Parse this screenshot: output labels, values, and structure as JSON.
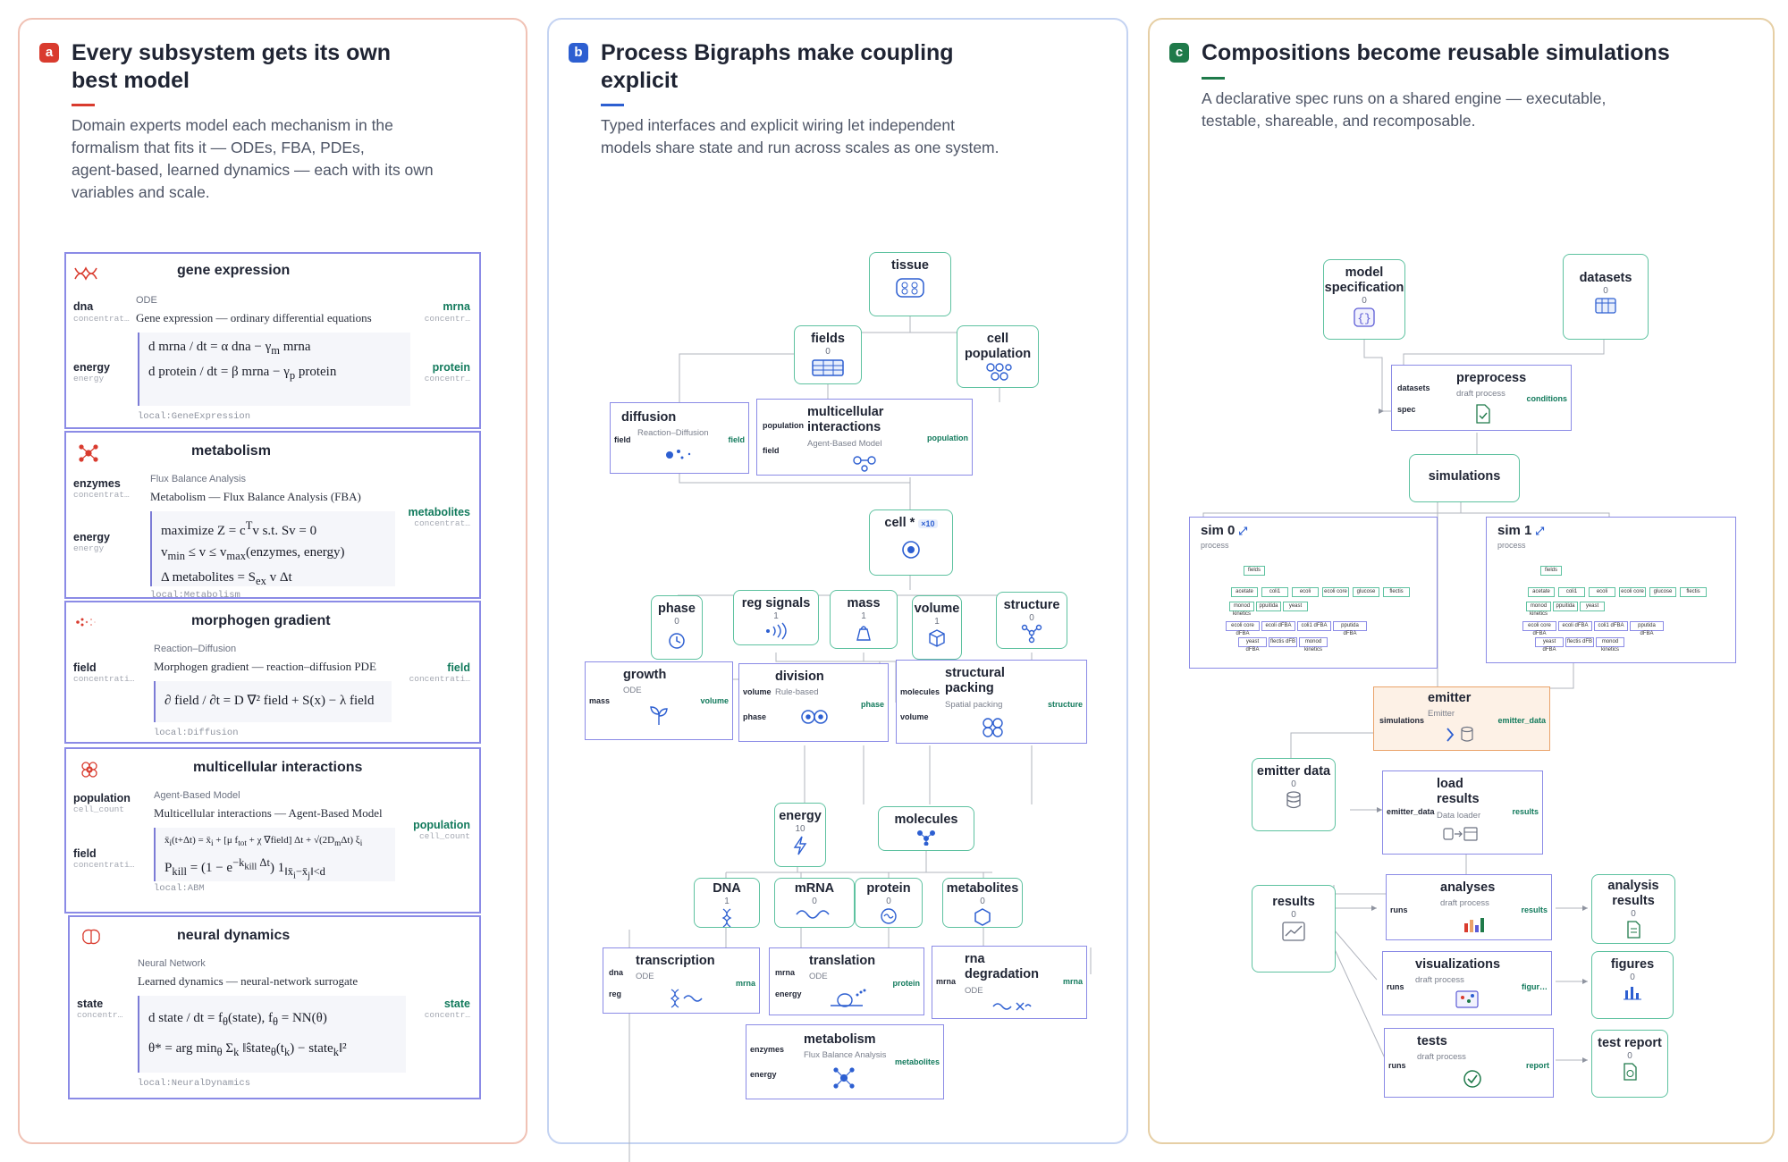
{
  "panels": {
    "a": {
      "badge": "a",
      "title_line1": "Every subsystem gets its own",
      "title_line2": "best model",
      "subtitle": [
        "Domain experts model each mechanism in the",
        "formalism that fits it — ODEs, FBA, PDEs,",
        "agent-based, learned dynamics — each with its own",
        "variables and scale."
      ],
      "cards": [
        {
          "title": "gene expression",
          "type": "ODE",
          "desc": "Gene expression — ordinary differential equations",
          "inputs": [
            {
              "name": "dna",
              "sub": "concentrat…"
            },
            {
              "name": "energy",
              "sub": "energy"
            }
          ],
          "outputs": [
            {
              "name": "mrna",
              "sub": "concentr…"
            },
            {
              "name": "protein",
              "sub": "concentr…"
            }
          ],
          "local": "local:GeneExpression",
          "icon": "dna-helix-icon"
        },
        {
          "title": "metabolism",
          "type": "Flux Balance Analysis",
          "desc": "Metabolism — Flux Balance Analysis (FBA)",
          "inputs": [
            {
              "name": "enzymes",
              "sub": "concentrat…"
            },
            {
              "name": "energy",
              "sub": "energy"
            }
          ],
          "outputs": [
            {
              "name": "metabolites",
              "sub": "concentrat…"
            }
          ],
          "local": "local:Metabolism",
          "icon": "network-icon"
        },
        {
          "title": "morphogen gradient",
          "type": "Reaction–Diffusion",
          "desc": "Morphogen gradient — reaction–diffusion PDE",
          "inputs": [
            {
              "name": "field",
              "sub": "concentrati…"
            }
          ],
          "outputs": [
            {
              "name": "field",
              "sub": "concentrati…"
            }
          ],
          "local": "local:Diffusion",
          "icon": "gradient-dots-icon"
        },
        {
          "title": "multicellular interactions",
          "type": "Agent-Based Model",
          "desc": "Multicellular interactions — Agent-Based Model",
          "inputs": [
            {
              "name": "population",
              "sub": "cell_count"
            },
            {
              "name": "field",
              "sub": "concentrati…"
            }
          ],
          "outputs": [
            {
              "name": "population",
              "sub": "cell_count"
            }
          ],
          "local": "local:ABM",
          "icon": "cells-cluster-icon"
        },
        {
          "title": "neural dynamics",
          "type": "Neural Network",
          "desc": "Learned dynamics — neural-network surrogate",
          "inputs": [
            {
              "name": "state",
              "sub": "concentr…"
            }
          ],
          "outputs": [
            {
              "name": "state",
              "sub": "concentr…"
            }
          ],
          "local": "local:NeuralDynamics",
          "icon": "brain-icon"
        }
      ],
      "equations": {
        "gene": [
          "d mrna / dt = α dna − γ<sub>m</sub> mrna",
          "d protein / dt = β mrna − γ<sub>p</sub> protein"
        ],
        "metab": [
          "maximize  Z = c<sup>T</sup>v   s.t.   Sv = 0",
          "v<sub>min</sub> ≤ v ≤ v<sub>max</sub>(enzymes, energy)",
          "Δ metabolites = S<sub>ex</sub> v Δt"
        ],
        "morph": [
          "∂ field / ∂t = D ∇² field + S(x) − λ field"
        ],
        "abm": [
          "x̄<sub>i</sub>(t+Δt) = x̄<sub>i</sub> + [μ f<sub>tot</sub> + χ ∇field] Δt + √(2D<sub>m</sub>Δt) ξ<sub>i</sub>",
          "P<sub>kill</sub> = (1 − e<sup>−k<sub>kill</sub> Δt</sup>) 1<sub>‖x̄<sub>i</sub>−x̄<sub>j</sub>‖&lt;d</sub>"
        ],
        "neural": [
          "d state / dt = f<sub>θ</sub>(state),   f<sub>θ</sub> = NN(θ)",
          "θ* = arg min<sub>θ</sub> Σ<sub>k</sub> ‖ŝtate<sub>θ</sub>(t<sub>k</sub>) − state<sub>k</sub>‖²"
        ]
      }
    },
    "b": {
      "badge": "b",
      "title_line1": "Process Bigraphs make coupling",
      "title_line2": "explicit",
      "subtitle": [
        "Typed interfaces and explicit wiring let independent",
        "models share state and run across scales as one system."
      ],
      "stores": {
        "tissue": {
          "label": "tissue"
        },
        "fields": {
          "label": "fields",
          "count": "0"
        },
        "cell_population": {
          "label": "cell population"
        },
        "cell": {
          "label": "cell *",
          "mult": "×10"
        },
        "phase": {
          "label": "phase",
          "count": "0"
        },
        "reg_signals": {
          "label": "reg signals",
          "count": "1"
        },
        "mass": {
          "label": "mass",
          "count": "1"
        },
        "volume": {
          "label": "volume",
          "count": "1"
        },
        "structure": {
          "label": "structure",
          "count": "0"
        },
        "energy": {
          "label": "energy",
          "count": "10"
        },
        "molecules": {
          "label": "molecules"
        },
        "dna": {
          "label": "DNA",
          "count": "1"
        },
        "mrna": {
          "label": "mRNA",
          "count": "0"
        },
        "protein": {
          "label": "protein",
          "count": "0"
        },
        "metabolites": {
          "label": "metabolites",
          "count": "0"
        }
      },
      "processes": {
        "diffusion": {
          "label": "diffusion",
          "type": "Reaction–Diffusion",
          "in": [
            "field"
          ],
          "out": [
            "field"
          ]
        },
        "multicellular": {
          "label": "multicellular interactions",
          "type": "Agent-Based Model",
          "in": [
            "population",
            "field"
          ],
          "out": [
            "population"
          ]
        },
        "growth": {
          "label": "growth",
          "type": "ODE",
          "in": [
            "mass"
          ],
          "out": [
            "volume"
          ]
        },
        "division": {
          "label": "division",
          "type": "Rule-based",
          "in": [
            "volume",
            "phase"
          ],
          "out": [
            "phase"
          ]
        },
        "packing": {
          "label": "structural packing",
          "type": "Spatial packing",
          "in": [
            "molecules",
            "volume"
          ],
          "out": [
            "structure"
          ]
        },
        "transcription": {
          "label": "transcription",
          "type": "ODE",
          "in": [
            "dna",
            "reg"
          ],
          "out": [
            "mrna"
          ]
        },
        "translation": {
          "label": "translation",
          "type": "ODE",
          "in": [
            "mrna",
            "energy"
          ],
          "out": [
            "protein"
          ]
        },
        "rna_degradation": {
          "label": "rna degradation",
          "type": "ODE",
          "in": [
            "mrna"
          ],
          "out": [
            "mrna"
          ]
        },
        "metabolism": {
          "label": "metabolism",
          "type": "Flux Balance Analysis",
          "in": [
            "enzymes",
            "energy"
          ],
          "out": [
            "metabolites"
          ]
        }
      }
    },
    "c": {
      "badge": "c",
      "title": "Compositions become reusable simulations",
      "subtitle": [
        "A declarative spec runs on a shared engine — executable,",
        "testable, shareable, and recomposable."
      ],
      "stores": {
        "model_spec": {
          "label": "model specification",
          "count": "0"
        },
        "datasets": {
          "label": "datasets",
          "count": "0"
        },
        "simulations": {
          "label": "simulations"
        },
        "emitter_data": {
          "label": "emitter data",
          "count": "0"
        },
        "results": {
          "label": "results",
          "count": "0"
        },
        "analysis_results": {
          "label": "analysis results",
          "count": "0"
        },
        "figures": {
          "label": "figures",
          "count": "0"
        },
        "test_report": {
          "label": "test report",
          "count": "0"
        }
      },
      "processes": {
        "preprocess": {
          "label": "preprocess",
          "type": "draft process",
          "in": [
            "datasets",
            "spec"
          ],
          "out": [
            "conditions"
          ]
        },
        "sim0": {
          "label": "sim 0",
          "type": "process"
        },
        "sim1": {
          "label": "sim 1",
          "type": "process"
        },
        "emitter": {
          "label": "emitter",
          "type": "Emitter",
          "in": [
            "simulations"
          ],
          "out": [
            "emitter_data"
          ]
        },
        "load_results": {
          "label": "load results",
          "type": "Data loader",
          "in": [
            "emitter_data"
          ],
          "out": [
            "results"
          ]
        },
        "analyses": {
          "label": "analyses",
          "type": "draft process",
          "in": [
            "runs"
          ],
          "out": [
            "results"
          ]
        },
        "visualizations": {
          "label": "visualizations",
          "type": "draft process",
          "in": [
            "runs"
          ],
          "out": [
            "figur…"
          ]
        },
        "tests": {
          "label": "tests",
          "type": "draft process",
          "in": [
            "runs"
          ],
          "out": [
            "report"
          ]
        }
      },
      "mini_graph": {
        "fields": "fields",
        "row1": [
          "acetate",
          "coli1",
          "ecoli",
          "ecoli core",
          "glucose",
          "flectis"
        ],
        "row2": [
          "monod kinetics",
          "ppuitida",
          "yeast"
        ],
        "row3": [
          "ecoli core dFBA",
          "ecoli dFBA",
          "coli1 dFBA",
          "pputida dFBA"
        ],
        "row4": [
          "yeast dFBA",
          "flectis dFB",
          "monod kinetics"
        ]
      }
    }
  },
  "colors": {
    "a": "#d93b2e",
    "b": "#2d5fd1",
    "c": "#1f7a4a",
    "store": "#5ec2a0",
    "process": "#8b8be6",
    "emitter_bg": "#fdf1e6",
    "emitter_border": "#eaa36a"
  }
}
